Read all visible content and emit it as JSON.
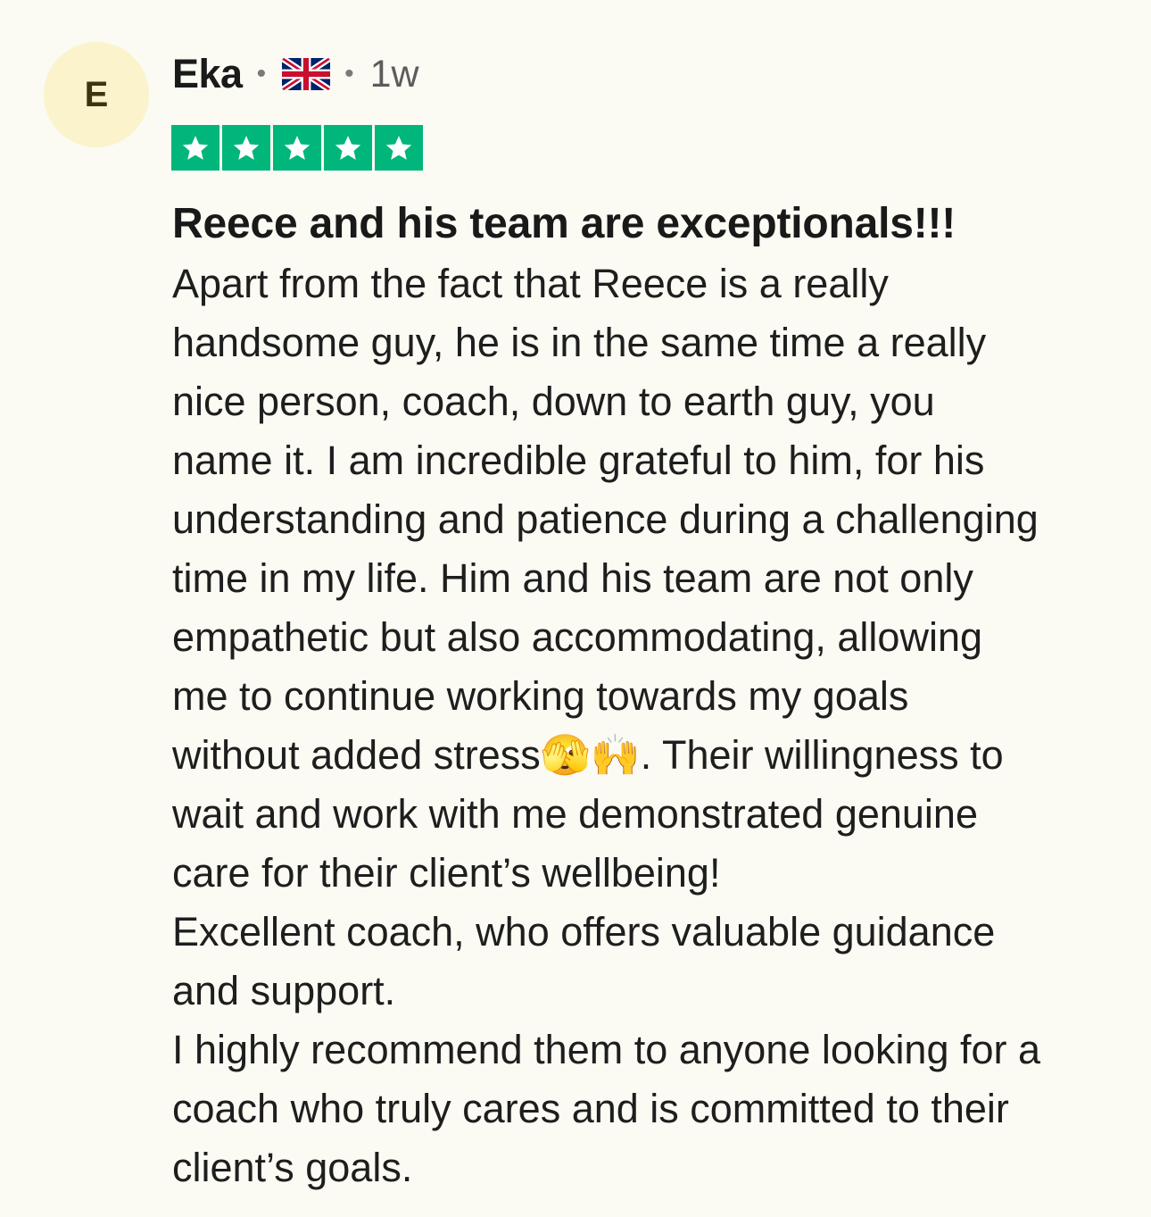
{
  "review": {
    "avatar_initial": "E",
    "author_name": "Eka",
    "separator": "•",
    "country_flag_icon": "uk-flag-icon",
    "age": "1w",
    "rating": 5,
    "rating_max": 5,
    "star_color": "#00b67a",
    "title": "Reece and his team are exceptionals!!!",
    "body_lines": [
      "Apart from the fact that Reece is a really",
      "handsome guy, he is in the same time a really",
      "nice person, coach, down to earth guy, you",
      "name it. I am incredible grateful to him, for his",
      "understanding and patience during a challenging",
      "time in my life. Him and his team are not only",
      "empathetic but also accommodating, allowing",
      "me to continue working towards my goals",
      "without added stress🫣🙌. Their willingness to",
      "wait and work with me demonstrated genuine",
      "care for their client’s wellbeing!",
      "Excellent coach, who offers valuable guidance",
      "and support.",
      "I highly recommend them to anyone looking for a",
      "coach who truly cares and is committed to their",
      "client’s goals."
    ]
  }
}
